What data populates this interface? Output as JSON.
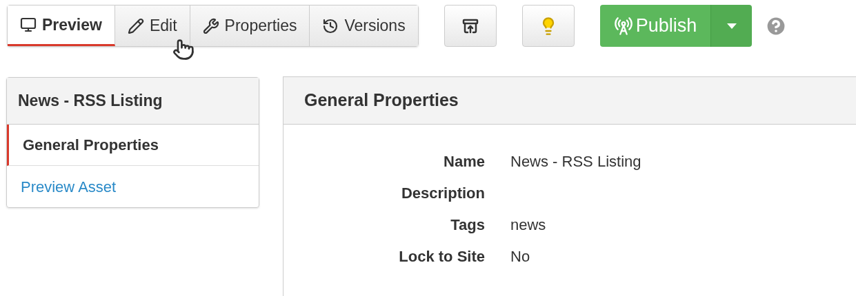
{
  "tabs": [
    {
      "label": "Preview",
      "kind": "preview",
      "selected": true
    },
    {
      "label": "Edit",
      "kind": "edit",
      "selected": false
    },
    {
      "label": "Properties",
      "kind": "properties",
      "selected": false
    },
    {
      "label": "Versions",
      "kind": "versions",
      "selected": false
    }
  ],
  "publish": {
    "label": "Publish"
  },
  "sidebar": {
    "title": "News - RSS Listing",
    "items": [
      {
        "label": "General Properties",
        "selected": true
      },
      {
        "label": "Preview Asset",
        "selected": false
      }
    ]
  },
  "panel": {
    "title": "General Properties",
    "fields": [
      {
        "label": "Name",
        "value": "News - RSS Listing"
      },
      {
        "label": "Description"
      },
      {
        "label": "Tags",
        "value": "news"
      },
      {
        "label": "Lock to Site",
        "value": "No"
      }
    ]
  }
}
